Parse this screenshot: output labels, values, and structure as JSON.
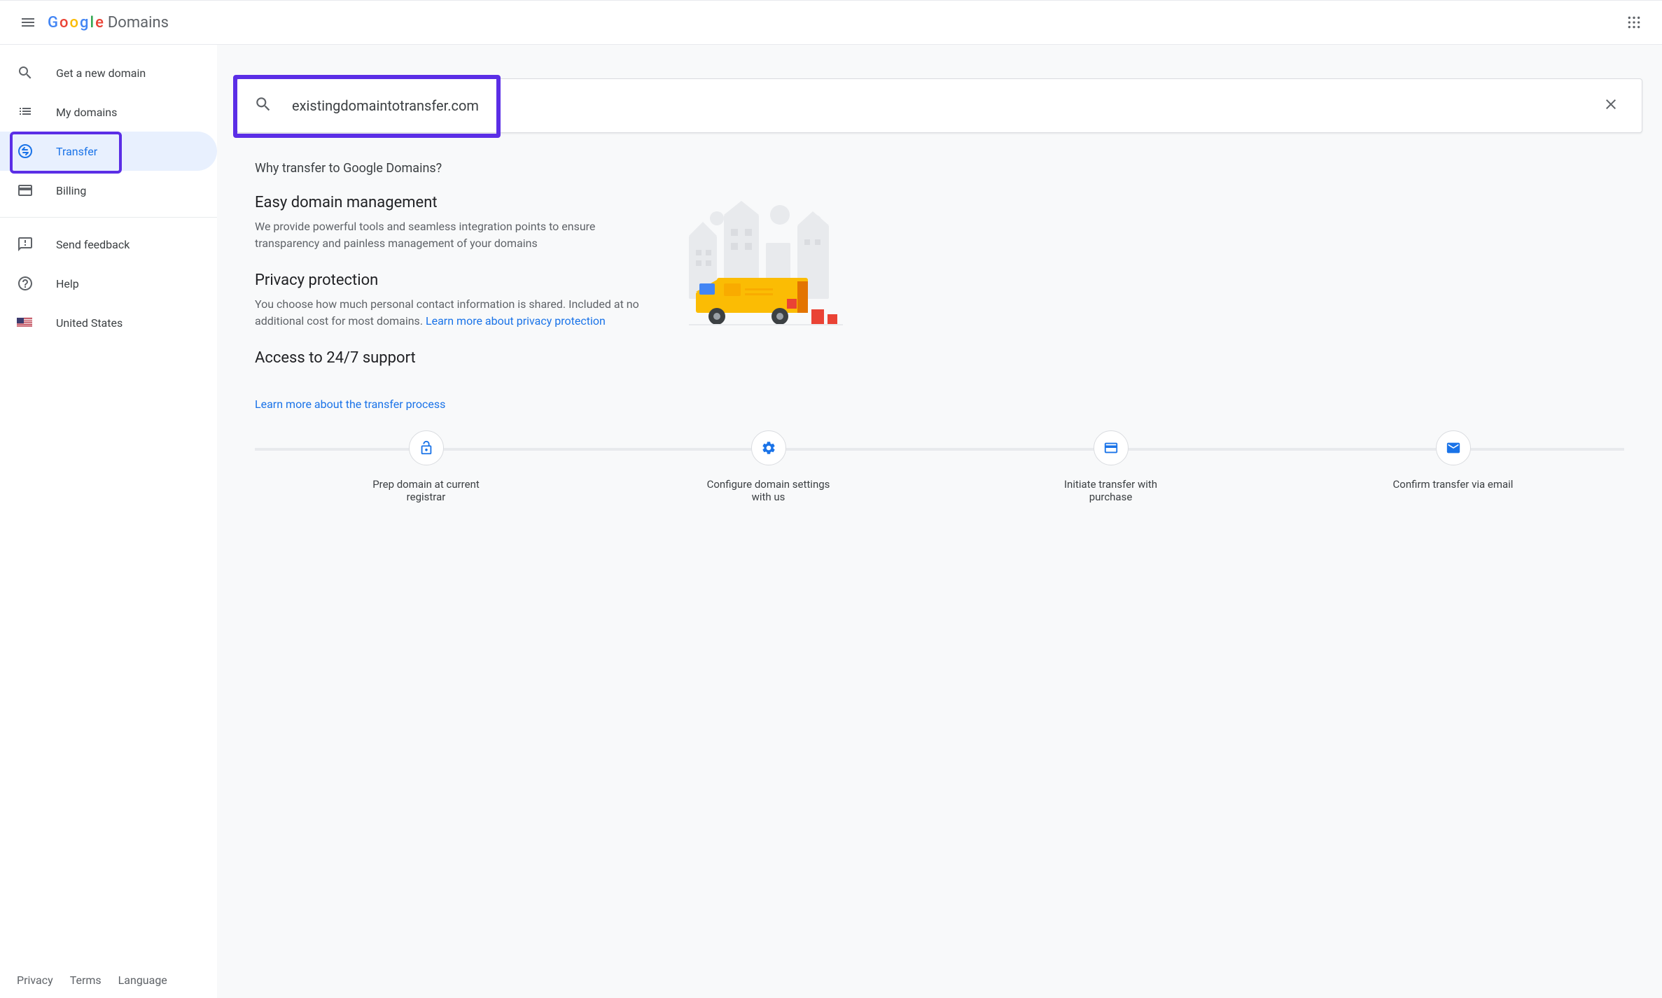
{
  "header": {
    "logo_text": "Domains"
  },
  "sidebar": {
    "items": [
      {
        "id": "get-new-domain",
        "label": "Get a new domain"
      },
      {
        "id": "my-domains",
        "label": "My domains"
      },
      {
        "id": "transfer",
        "label": "Transfer",
        "active": true
      },
      {
        "id": "billing",
        "label": "Billing"
      }
    ],
    "secondary": [
      {
        "id": "send-feedback",
        "label": "Send feedback"
      },
      {
        "id": "help",
        "label": "Help"
      },
      {
        "id": "locale",
        "label": "United States"
      }
    ],
    "footer": {
      "privacy": "Privacy",
      "terms": "Terms",
      "language": "Language"
    }
  },
  "search": {
    "value": "existingdomaintotransfer.com",
    "placeholder": ""
  },
  "why": {
    "heading": "Why transfer to Google Domains?",
    "features": [
      {
        "title": "Easy domain management",
        "body": "We provide powerful tools and seamless integration points to ensure transparency and painless management of your domains"
      },
      {
        "title": "Privacy protection",
        "body": "You choose how much personal contact information is shared. Included at no additional cost for most domains. ",
        "link": "Learn more about privacy protection"
      },
      {
        "title": "Access to 24/7 support",
        "body": ""
      }
    ],
    "learn_link": "Learn more about the transfer process",
    "steps": [
      "Prep domain at current registrar",
      "Configure domain settings with us",
      "Initiate transfer with purchase",
      "Confirm transfer via email"
    ]
  }
}
